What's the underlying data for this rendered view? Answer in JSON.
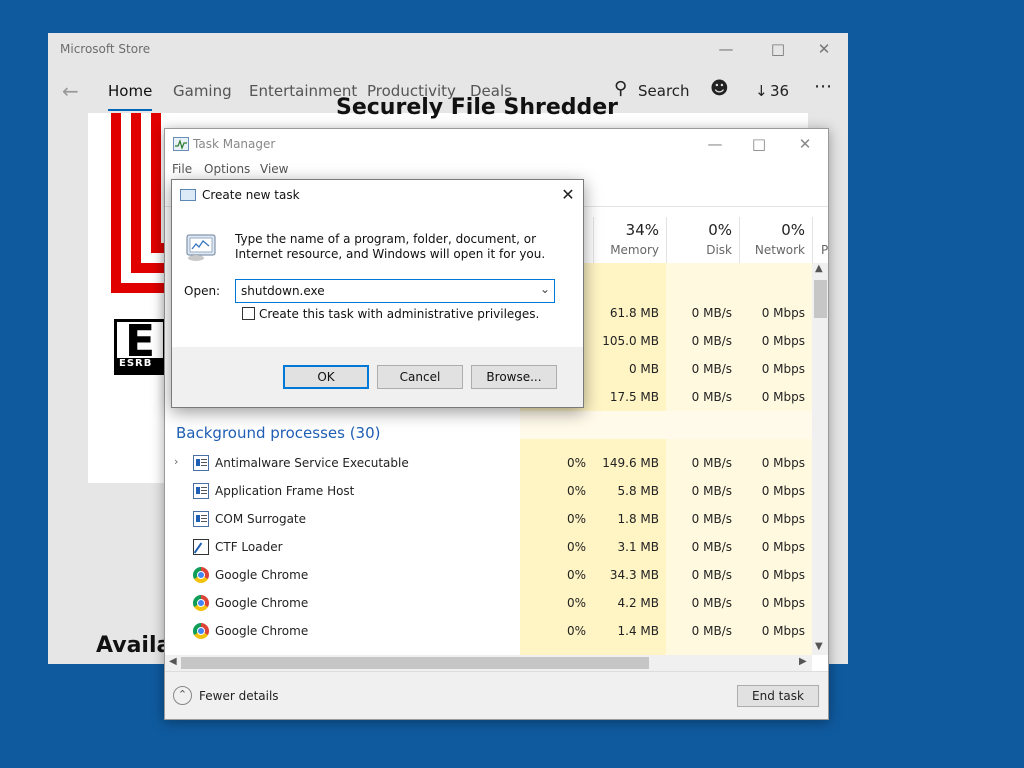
{
  "store": {
    "title": "Microsoft Store",
    "tabs": [
      "Home",
      "Gaming",
      "Entertainment",
      "Productivity",
      "Deals"
    ],
    "search_label": "Search",
    "downloads_count": "36",
    "app_title": "Securely File Shredder",
    "esrb_letter": "E",
    "esrb_band": "ESRB",
    "available_text": "Availa"
  },
  "taskmgr": {
    "title": "Task Manager",
    "menu": [
      "File",
      "Options",
      "View"
    ],
    "columns": [
      {
        "pct": "34%",
        "name": "Memory"
      },
      {
        "pct": "0%",
        "name": "Disk"
      },
      {
        "pct": "0%",
        "name": "Network"
      },
      {
        "pct": "",
        "name": "P"
      }
    ],
    "top_rows": [
      {
        "memory": "61.8 MB",
        "disk": "0 MB/s",
        "network": "0 Mbps"
      },
      {
        "memory": "105.0 MB",
        "disk": "0 MB/s",
        "network": "0 Mbps"
      },
      {
        "memory": "0 MB",
        "disk": "0 MB/s",
        "network": "0 Mbps"
      },
      {
        "memory": "17.5 MB",
        "disk": "0 MB/s",
        "network": "0 Mbps"
      }
    ],
    "background_header": "Background processes (30)",
    "processes": [
      {
        "name": "Antimalware Service Executable",
        "icon": "app-window-icon",
        "cpu": "0%",
        "memory": "149.6 MB",
        "disk": "0 MB/s",
        "network": "0 Mbps",
        "expandable": true
      },
      {
        "name": "Application Frame Host",
        "icon": "app-window-icon",
        "cpu": "0%",
        "memory": "5.8 MB",
        "disk": "0 MB/s",
        "network": "0 Mbps"
      },
      {
        "name": "COM Surrogate",
        "icon": "app-window-icon",
        "cpu": "0%",
        "memory": "1.8 MB",
        "disk": "0 MB/s",
        "network": "0 Mbps"
      },
      {
        "name": "CTF Loader",
        "icon": "pen-icon",
        "cpu": "0%",
        "memory": "3.1 MB",
        "disk": "0 MB/s",
        "network": "0 Mbps"
      },
      {
        "name": "Google Chrome",
        "icon": "chrome-icon",
        "cpu": "0%",
        "memory": "34.3 MB",
        "disk": "0 MB/s",
        "network": "0 Mbps"
      },
      {
        "name": "Google Chrome",
        "icon": "chrome-icon",
        "cpu": "0%",
        "memory": "4.2 MB",
        "disk": "0 MB/s",
        "network": "0 Mbps"
      },
      {
        "name": "Google Chrome",
        "icon": "chrome-icon",
        "cpu": "0%",
        "memory": "1.4 MB",
        "disk": "0 MB/s",
        "network": "0 Mbps"
      }
    ],
    "fewer_details": "Fewer details",
    "end_task": "End task"
  },
  "dialog": {
    "title": "Create new task",
    "description": "Type the name of a program, folder, document, or Internet resource, and Windows will open it for you.",
    "open_label": "Open:",
    "open_value": "shutdown.exe",
    "admin_checkbox_label": "Create this task with administrative privileges.",
    "admin_checked": false,
    "ok": "OK",
    "cancel": "Cancel",
    "browse": "Browse..."
  }
}
